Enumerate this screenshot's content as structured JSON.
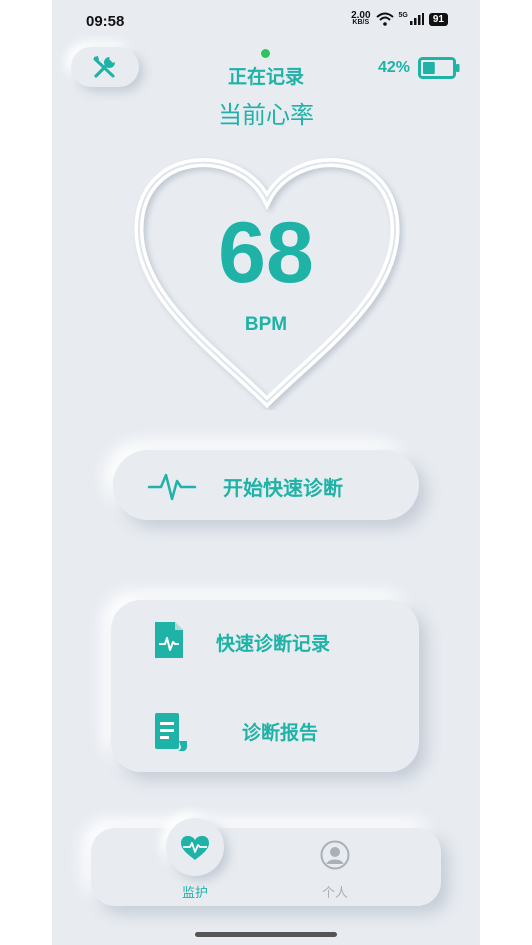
{
  "status_bar": {
    "time": "09:58",
    "net_speed_value": "2.00",
    "net_speed_unit": "KB/S",
    "network_type": "5G",
    "battery_level": "91"
  },
  "header": {
    "recording_status": "正在记录",
    "title": "当前心率",
    "battery_percent": "42%",
    "battery_fill": 0.42
  },
  "heart_rate": {
    "value": "68",
    "unit": "BPM"
  },
  "actions": {
    "start_diagnosis": "开始快速诊断"
  },
  "menu": {
    "records": "快速诊断记录",
    "report": "诊断报告"
  },
  "tabs": [
    {
      "label": "监护",
      "icon": "heart-pulse-icon",
      "active": true
    },
    {
      "label": "个人",
      "icon": "user-circle-icon",
      "active": false
    }
  ],
  "colors": {
    "accent": "#1fb2a6",
    "background": "#e8ecf1",
    "recording_dot": "#2ec35f",
    "inactive": "#a9b0b8"
  }
}
